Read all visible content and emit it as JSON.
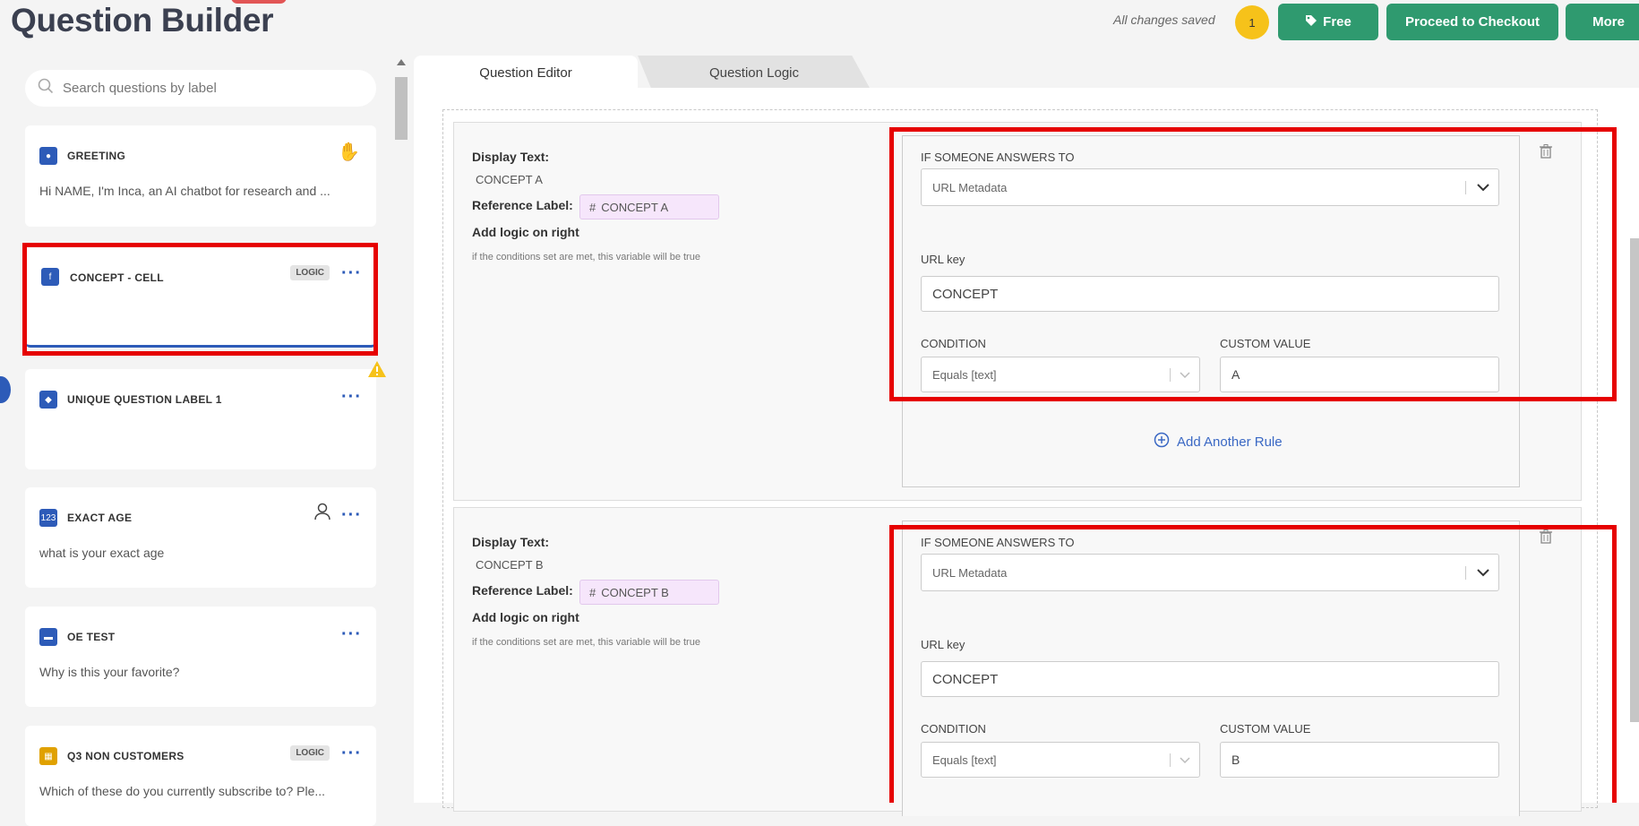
{
  "header": {
    "title": "Question Builder",
    "saved_text": "All changes saved",
    "notification_count": "1",
    "free_label": "Free",
    "checkout_label": "Proceed to Checkout",
    "more_label": "More"
  },
  "search": {
    "placeholder": "Search questions by label"
  },
  "questions": [
    {
      "label": "GREETING",
      "desc": "Hi NAME, I'm Inca, an AI chatbot for research and ..."
    },
    {
      "label": "CONCEPT - CELL",
      "badge": "LOGIC",
      "desc": ""
    },
    {
      "label": "UNIQUE QUESTION LABEL 1",
      "desc": ""
    },
    {
      "label": "EXACT AGE",
      "desc": "what is your exact age"
    },
    {
      "label": "OE TEST",
      "desc": "Why is this your favorite?"
    },
    {
      "label": "Q3 NON CUSTOMERS",
      "badge": "LOGIC",
      "desc": "Which of these do you currently subscribe to? Ple..."
    }
  ],
  "tabs": {
    "editor": "Question Editor",
    "logic": "Question Logic"
  },
  "rules": [
    {
      "display_text_label": "Display Text:",
      "display_text": "CONCEPT A",
      "ref_label_label": "Reference Label:",
      "ref_label": "CONCEPT A",
      "add_logic": "Add logic on right",
      "hint": "if the conditions set are met, this variable will be true",
      "if_label": "IF SOMEONE ANSWERS TO",
      "source": "URL Metadata",
      "url_key_label": "URL key",
      "url_key": "CONCEPT",
      "condition_label": "CONDITION",
      "condition": "Equals [text]",
      "custom_label": "CUSTOM VALUE",
      "custom_value": "A",
      "add_rule": "Add Another Rule"
    },
    {
      "display_text_label": "Display Text:",
      "display_text": "CONCEPT B",
      "ref_label_label": "Reference Label:",
      "ref_label": "CONCEPT B",
      "add_logic": "Add logic on right",
      "hint": "if the conditions set are met, this variable will be true",
      "if_label": "IF SOMEONE ANSWERS TO",
      "source": "URL Metadata",
      "url_key_label": "URL key",
      "url_key": "CONCEPT",
      "condition_label": "CONDITION",
      "condition": "Equals [text]",
      "custom_label": "CUSTOM VALUE",
      "custom_value": "B"
    }
  ],
  "colors": {
    "accent_green": "#2f9a6f",
    "accent_blue": "#2d5bb8",
    "highlight_red": "#e60000",
    "warning": "#f6c21a"
  }
}
